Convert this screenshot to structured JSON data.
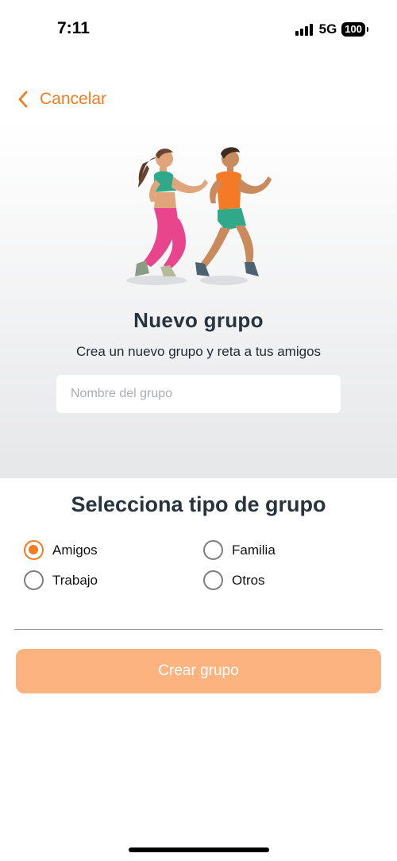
{
  "status_bar": {
    "time": "7:11",
    "network": "5G",
    "battery": "100"
  },
  "nav": {
    "cancel_label": "Cancelar"
  },
  "header": {
    "title": "Nuevo grupo",
    "subtitle": "Crea un nuevo grupo y reta a tus amigos"
  },
  "group_name": {
    "placeholder": "Nombre del grupo",
    "value": ""
  },
  "group_type": {
    "title": "Selecciona tipo de grupo",
    "options": [
      {
        "label": "Amigos",
        "selected": true
      },
      {
        "label": "Familia",
        "selected": false
      },
      {
        "label": "Trabajo",
        "selected": false
      },
      {
        "label": "Otros",
        "selected": false
      }
    ]
  },
  "actions": {
    "create_label": "Crear grupo"
  },
  "colors": {
    "accent": "#f07d22",
    "button_disabled": "#fcb380"
  },
  "icons": {
    "back": "chevron-left-icon",
    "illustration": "runners-illustration"
  }
}
